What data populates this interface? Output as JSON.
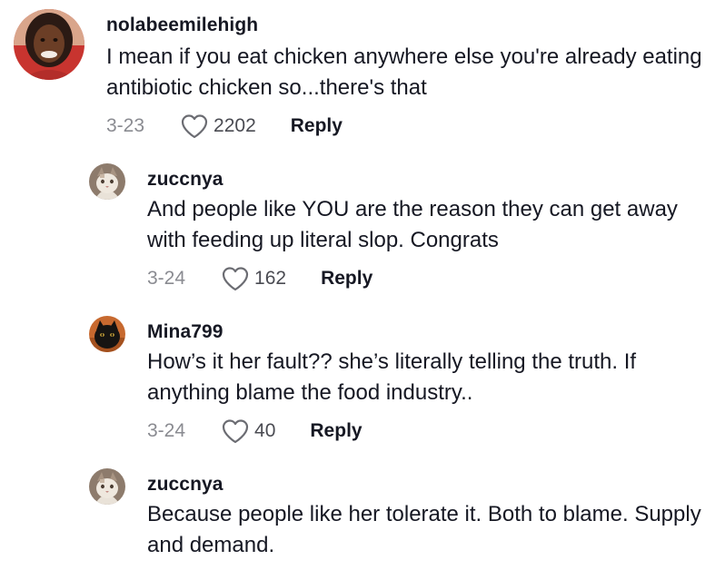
{
  "comments": [
    {
      "username": "nolabeemilehigh",
      "text": "I mean if you eat chicken anywhere else you're already eating antibiotic chicken so...there's that",
      "date": "3-23",
      "likes": "2202",
      "reply_label": "Reply",
      "avatar_icon": "user-photo-avatar"
    },
    {
      "username": "zuccnya",
      "text": "And people like YOU are the reason they can get away with feeding up literal slop. Congrats",
      "date": "3-24",
      "likes": "162",
      "reply_label": "Reply",
      "avatar_icon": "cat-photo-avatar"
    },
    {
      "username": "Mina799",
      "text": "How’s it her fault?? she’s literally telling the truth. If anything blame the food industry..",
      "date": "3-24",
      "likes": "40",
      "reply_label": "Reply",
      "avatar_icon": "black-cat-photo-avatar"
    },
    {
      "username": "zuccnya",
      "text": "Because people like her tolerate it. Both to blame. Supply and demand.",
      "avatar_icon": "cat-photo-avatar"
    }
  ],
  "colors": {
    "text": "#161823",
    "secondary": "#8a8b91",
    "background": "#ffffff"
  }
}
